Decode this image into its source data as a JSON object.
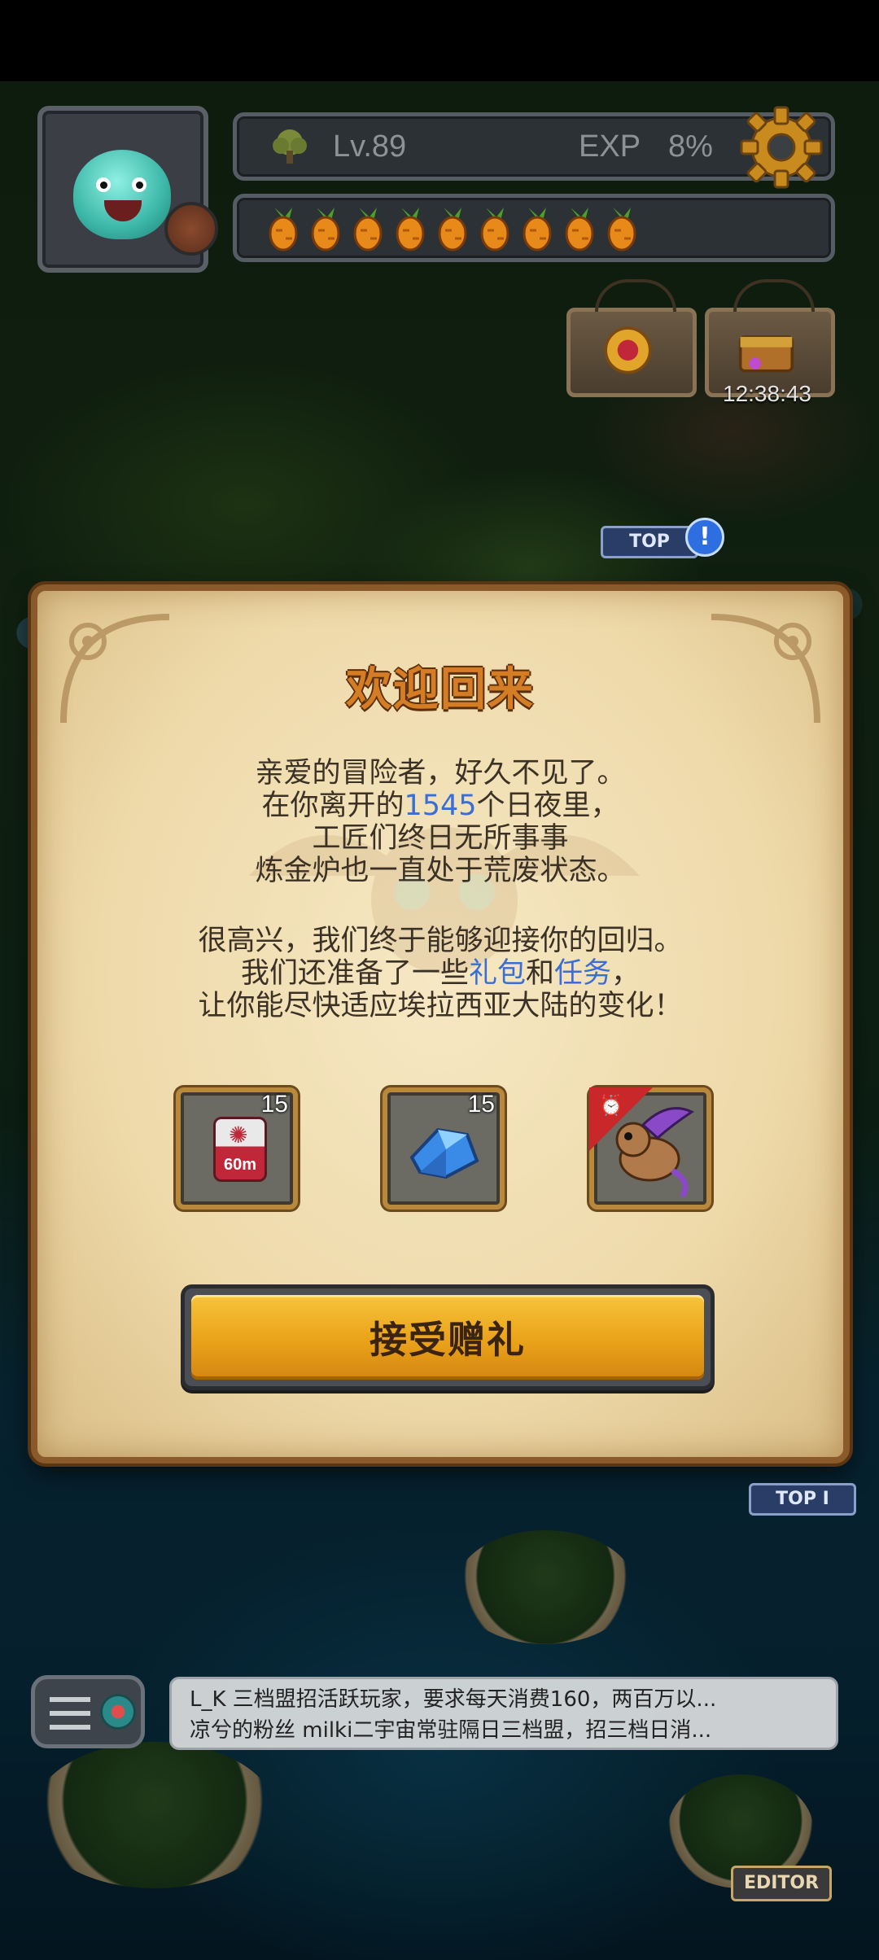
{
  "hud": {
    "level": "Lv.89",
    "exp_label": "EXP",
    "exp_value": "8%",
    "energy_count": 9,
    "timer": "12:38:43"
  },
  "map": {
    "top_badge_1": "TOP",
    "top_badge_2": "TOP I",
    "alert": "!",
    "editor_badge": "EDITOR"
  },
  "dialog": {
    "title": "欢迎回来",
    "paragraph1": {
      "line1": "亲爱的冒险者，好久不见了。",
      "line2_before": "在你离开的",
      "line2_days": "1545",
      "line2_after": "个日夜里，",
      "line3": "工匠们终日无所事事",
      "line4": "炼金炉也一直处于荒废状态。"
    },
    "paragraph2": {
      "line1": "很高兴，我们终于能够迎接你的回归。",
      "line2_before": "我们还准备了一些",
      "line2_link1": "礼包",
      "line2_mid": "和",
      "line2_link2": "任务",
      "line2_after": "，",
      "line3": "让你能尽快适应埃拉西亚大陆的变化！"
    },
    "rewards": [
      {
        "icon": "chest-60m-icon",
        "label": "60m",
        "count": "15"
      },
      {
        "icon": "blue-crystal-icon",
        "count": "15"
      },
      {
        "icon": "dragon-pet-icon",
        "ribbon": "clock-icon"
      }
    ],
    "accept_button": "接受赠礼"
  },
  "chat": {
    "line1": "L_K 三档盟招活跃玩家，要求每天消费160，两百万以...",
    "line2": "凉兮的粉丝 milki二宇宙常驻隔日三档盟，招三档日消..."
  },
  "colors": {
    "title": "#d47d24",
    "highlight": "#3b6ed4",
    "button": "#eaa21a",
    "panel": "#eed9a9"
  }
}
